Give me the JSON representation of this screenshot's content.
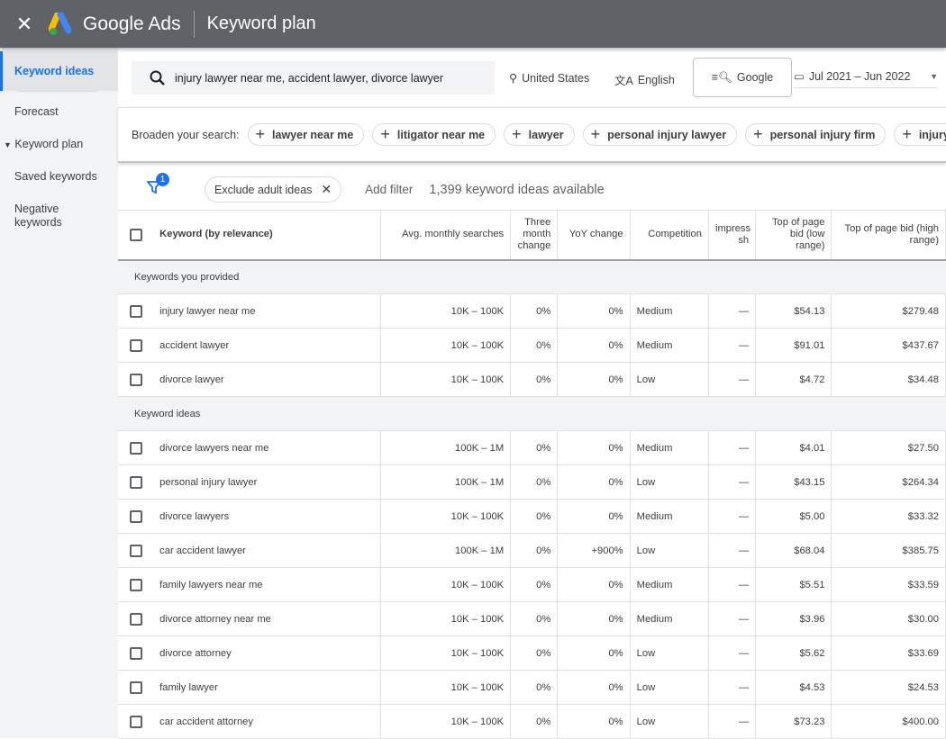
{
  "topbar": {
    "brand": "Google Ads",
    "title": "Keyword plan"
  },
  "sidebar": {
    "items": [
      {
        "label": "Keyword ideas"
      },
      {
        "label": "Forecast"
      },
      {
        "label": "Keyword plan"
      },
      {
        "label": "Saved keywords"
      },
      {
        "label": "Negative keywords"
      }
    ]
  },
  "search": {
    "value": "injury lawyer near me, accident lawyer, divorce lawyer",
    "location": "United States",
    "language": "English",
    "network": "Google",
    "date_range": "Jul 2021 – Jun 2022"
  },
  "broaden": {
    "label": "Broaden your search:",
    "chips": [
      "lawyer near me",
      "litigator near me",
      "lawyer",
      "personal injury lawyer",
      "personal injury firm",
      "injury lawyer"
    ]
  },
  "filters": {
    "badge": "1",
    "exclude_chip": "Exclude adult ideas",
    "add_filter": "Add filter",
    "count": "1,399 keyword ideas available"
  },
  "table": {
    "headers": [
      "Keyword (by relevance)",
      "Avg. monthly searches",
      "Three month change",
      "YoY change",
      "Competition",
      "impress sh",
      "Top of page bid (low range)",
      "Top of page bid (high range)"
    ],
    "groups": [
      {
        "label": "Keywords you provided",
        "rows": [
          [
            "injury lawyer near me",
            "10K – 100K",
            "0%",
            "0%",
            "Medium",
            "—",
            "$54.13",
            "$279.48"
          ],
          [
            "accident lawyer",
            "10K – 100K",
            "0%",
            "0%",
            "Medium",
            "—",
            "$91.01",
            "$437.67"
          ],
          [
            "divorce lawyer",
            "10K – 100K",
            "0%",
            "0%",
            "Low",
            "—",
            "$4.72",
            "$34.48"
          ]
        ]
      },
      {
        "label": "Keyword ideas",
        "rows": [
          [
            "divorce lawyers near me",
            "100K – 1M",
            "0%",
            "0%",
            "Medium",
            "—",
            "$4.01",
            "$27.50"
          ],
          [
            "personal injury lawyer",
            "100K – 1M",
            "0%",
            "0%",
            "Low",
            "—",
            "$43.15",
            "$264.34"
          ],
          [
            "divorce lawyers",
            "10K – 100K",
            "0%",
            "0%",
            "Medium",
            "—",
            "$5.00",
            "$33.32"
          ],
          [
            "car accident lawyer",
            "100K – 1M",
            "0%",
            "+900%",
            "Low",
            "—",
            "$68.04",
            "$385.75"
          ],
          [
            "family lawyers near me",
            "10K – 100K",
            "0%",
            "0%",
            "Medium",
            "—",
            "$5.51",
            "$33.59"
          ],
          [
            "divorce attorney near me",
            "10K – 100K",
            "0%",
            "0%",
            "Medium",
            "—",
            "$3.96",
            "$30.00"
          ],
          [
            "divorce attorney",
            "10K – 100K",
            "0%",
            "0%",
            "Low",
            "—",
            "$5.62",
            "$33.69"
          ],
          [
            "family lawyer",
            "10K – 100K",
            "0%",
            "0%",
            "Low",
            "—",
            "$4.53",
            "$24.53"
          ],
          [
            "car accident attorney",
            "10K – 100K",
            "0%",
            "0%",
            "Low",
            "—",
            "$73.23",
            "$400.00"
          ]
        ]
      }
    ]
  },
  "colors": {
    "topbar": "#5f6368",
    "accent": "#1a73e8"
  }
}
